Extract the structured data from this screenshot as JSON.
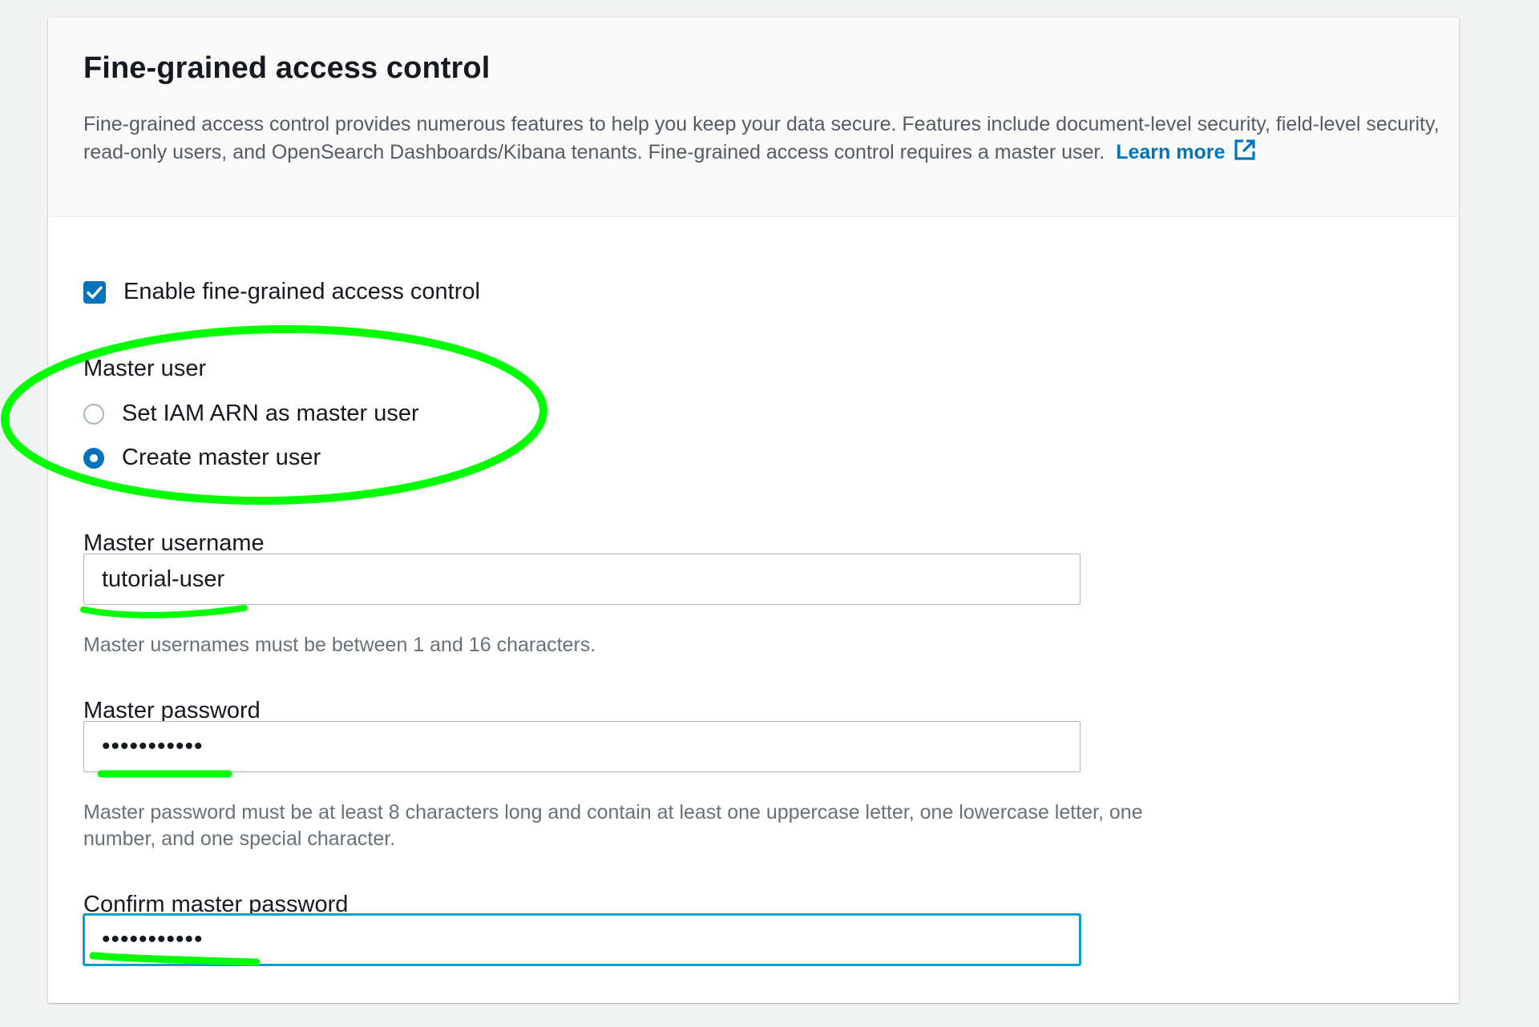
{
  "section": {
    "title": "Fine-grained access control",
    "description": "Fine-grained access control provides numerous features to help you keep your data secure. Features include document-level security, field-level security, read-only users, and OpenSearch Dashboards/Kibana tenants. Fine-grained access control requires a master user.",
    "learn_more": "Learn more"
  },
  "enable_checkbox": {
    "label": "Enable fine-grained access control",
    "checked": true
  },
  "master_user": {
    "label": "Master user",
    "options": [
      {
        "label": "Set IAM ARN as master user",
        "selected": false
      },
      {
        "label": "Create master user",
        "selected": true
      }
    ]
  },
  "username": {
    "label": "Master username",
    "value": "tutorial-user",
    "hint": "Master usernames must be between 1 and 16 characters."
  },
  "password": {
    "label": "Master password",
    "value": "•••••••••••",
    "hint": "Master password must be at least 8 characters long and contain at least one uppercase letter, one lowercase letter, one number, and one special character."
  },
  "confirm_password": {
    "label": "Confirm master password",
    "value": "•••••••••••"
  },
  "colors": {
    "accent": "#0073bb",
    "focus": "#00a1c9",
    "annotation": "#00ff00"
  }
}
